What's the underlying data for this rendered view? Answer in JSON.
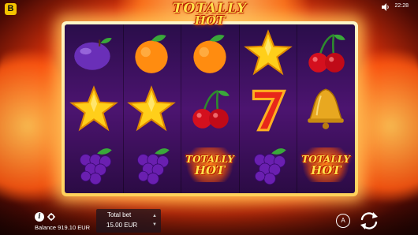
{
  "app": {
    "brand_badge": "B",
    "clock": "22:28",
    "logo": {
      "line1": "TOTALLY",
      "line2": "HOT"
    }
  },
  "reels": [
    [
      "plum",
      "orange",
      "orange",
      "star",
      "cherry"
    ],
    [
      "star",
      "star",
      "cherry",
      "seven",
      "bell"
    ],
    [
      "grapes",
      "grapes",
      "totally-hot",
      "grapes",
      "totally-hot"
    ]
  ],
  "symbol_labels": {
    "totally_hot_l1": "TOTALLY",
    "totally_hot_l2": "HOT"
  },
  "bottom": {
    "balance_label": "Balance 919.10 EUR",
    "total_bet_label": "Total bet",
    "total_bet_value": "15.00 EUR",
    "auto_label": "A"
  }
}
